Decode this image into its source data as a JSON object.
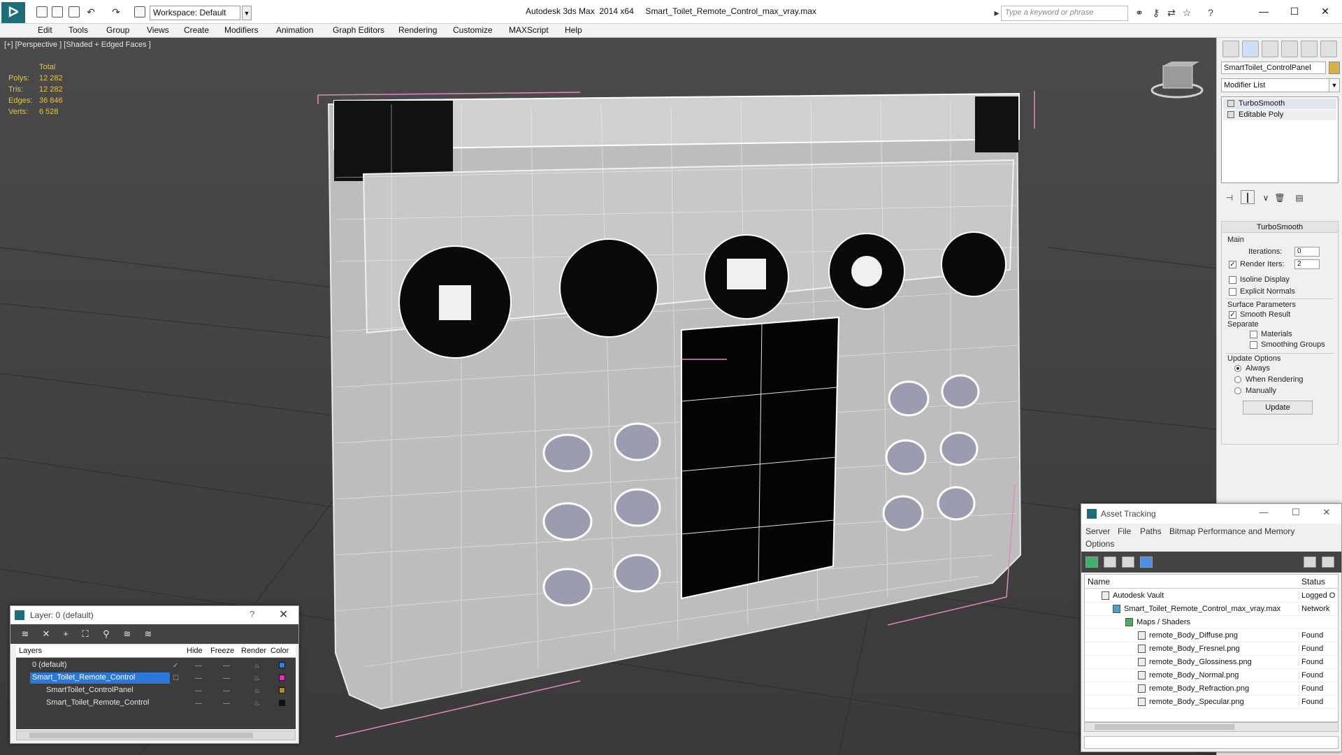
{
  "titlebar": {
    "workspace": "Workspace: Default",
    "title": "Autodesk 3ds Max  2014 x64     Smart_Toilet_Remote_Control_max_vray.max",
    "search_placeholder": "Type a keyword or phrase"
  },
  "menu": [
    "Edit",
    "Tools",
    "Group",
    "Views",
    "Create",
    "Modifiers",
    "Animation",
    "Graph Editors",
    "Rendering",
    "Customize",
    "MAXScript",
    "Help"
  ],
  "viewport": {
    "label": "[+] [Perspective ] [Shaded + Edged Faces ]",
    "stats": {
      "header": "Total",
      "rows": [
        {
          "label": "Polys:",
          "value": "12 282"
        },
        {
          "label": "Tris:",
          "value": "12 282"
        },
        {
          "label": "Edges:",
          "value": "36 846"
        },
        {
          "label": "Verts:",
          "value": "6 528"
        }
      ]
    }
  },
  "command_panel": {
    "object_name": "SmartToilet_ControlPanel",
    "object_color": "#d6b04a",
    "modifier_list": "Modifier List",
    "stack": [
      "TurboSmooth",
      "Editable Poly"
    ],
    "rollout_title": "TurboSmooth",
    "main_label": "Main",
    "iterations_label": "Iterations:",
    "iterations_value": "0",
    "render_iters_label": "Render Iters:",
    "render_iters_value": "2",
    "isoline": "Isoline Display",
    "explicit_normals": "Explicit Normals",
    "surface_params": "Surface Parameters",
    "smooth_result": "Smooth Result",
    "separate": "Separate",
    "materials": "Materials",
    "smoothing_groups": "Smoothing Groups",
    "update_options": "Update Options",
    "always": "Always",
    "when_rendering": "When Rendering",
    "manually": "Manually",
    "update_button": "Update"
  },
  "layer_window": {
    "title": "Layer: 0 (default)",
    "help": "?",
    "close": "✕",
    "columns": {
      "layers": "Layers",
      "hide": "Hide",
      "freeze": "Freeze",
      "render": "Render",
      "color": "Color"
    },
    "rows": [
      {
        "name": "0 (default)",
        "color": "#3a7ad8"
      },
      {
        "name": "Smart_Toilet_Remote_Control",
        "color": "#d23ab8"
      },
      {
        "name": "SmartToilet_ControlPanel",
        "color": "#b08a2a"
      },
      {
        "name": "Smart_Toilet_Remote_Control",
        "color": "#111111"
      }
    ]
  },
  "asset_window": {
    "title": "Asset Tracking",
    "menu": [
      "Server",
      "File",
      "Paths",
      "Bitmap Performance and Memory",
      "Options"
    ],
    "columns": {
      "name": "Name",
      "status": "Status"
    },
    "rows": [
      {
        "name": "Autodesk Vault",
        "status": "Logged O"
      },
      {
        "name": "Smart_Toilet_Remote_Control_max_vray.max",
        "status": "Network"
      },
      {
        "name": "Maps / Shaders",
        "status": ""
      },
      {
        "name": "remote_Body_Diffuse.png",
        "status": "Found"
      },
      {
        "name": "remote_Body_Fresnel.png",
        "status": "Found"
      },
      {
        "name": "remote_Body_Glossiness.png",
        "status": "Found"
      },
      {
        "name": "remote_Body_Normal.png",
        "status": "Found"
      },
      {
        "name": "remote_Body_Refraction.png",
        "status": "Found"
      },
      {
        "name": "remote_Body_Specular.png",
        "status": "Found"
      }
    ]
  }
}
